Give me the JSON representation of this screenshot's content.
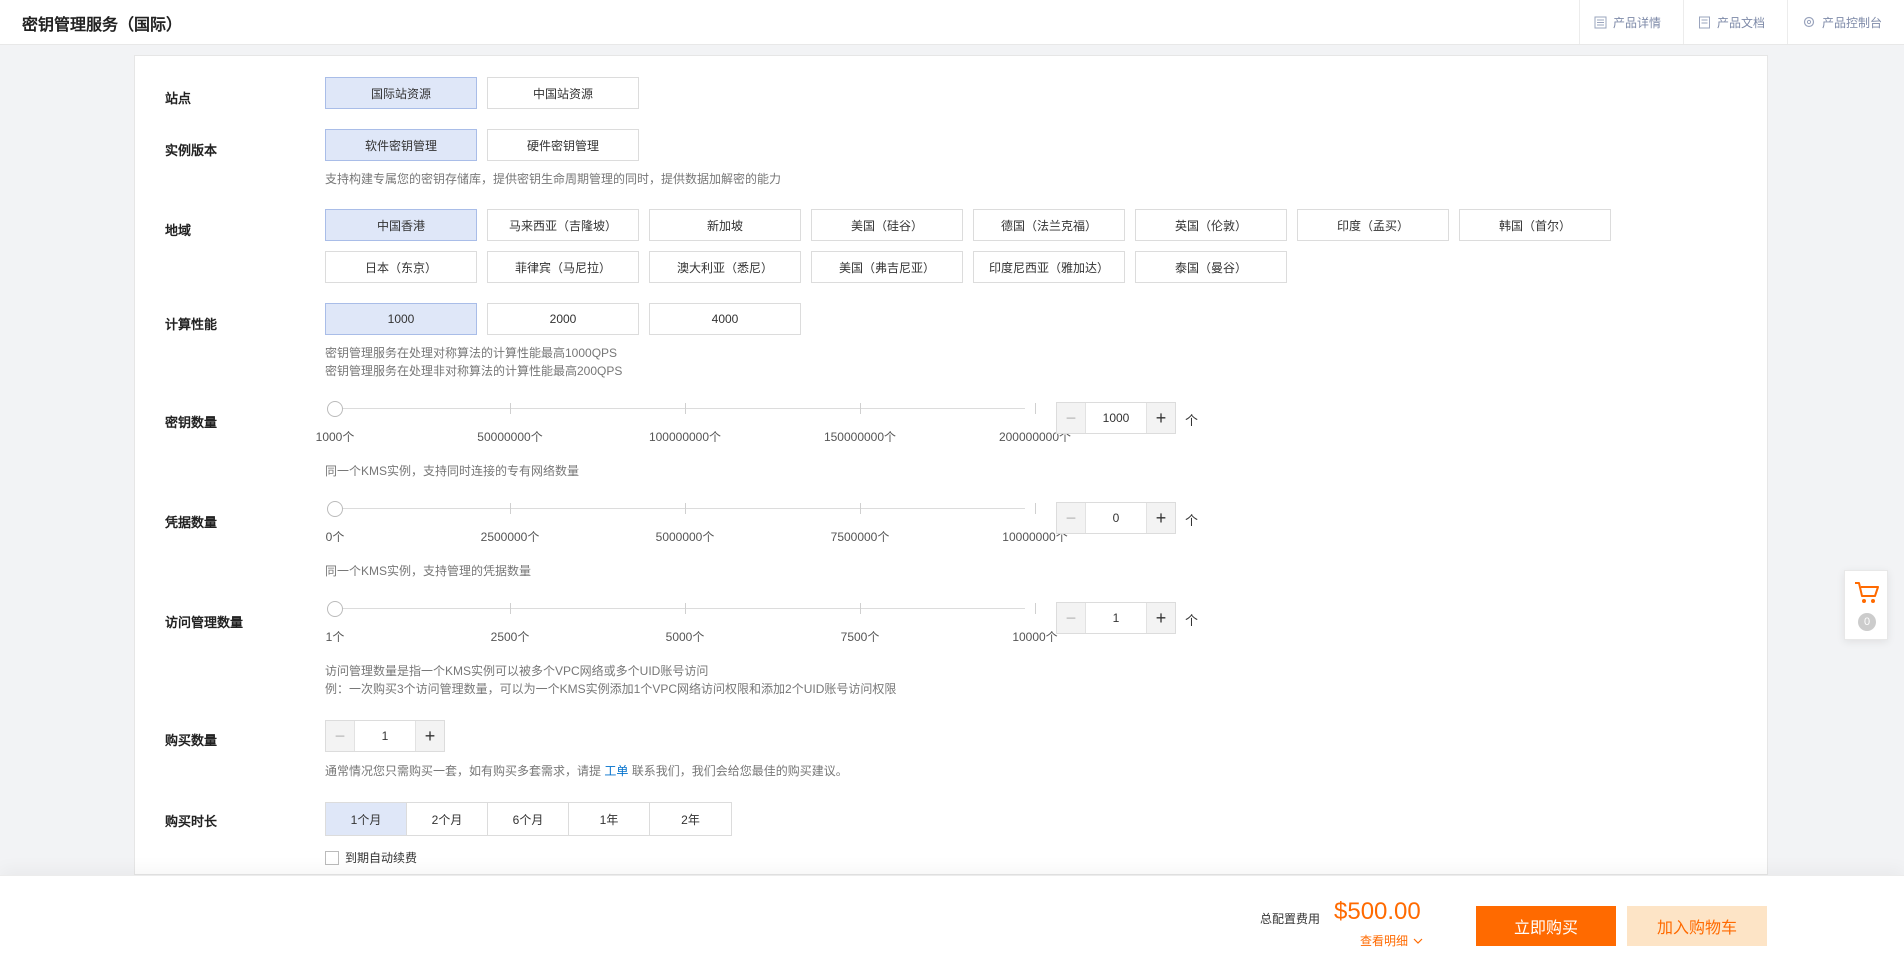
{
  "header": {
    "title": "密钥管理服务（国际）",
    "links": [
      "产品详情",
      "产品文档",
      "产品控制台"
    ]
  },
  "site": {
    "label": "站点",
    "options": [
      "国际站资源",
      "中国站资源"
    ],
    "selected": "国际站资源"
  },
  "edition": {
    "label": "实例版本",
    "options": [
      "软件密钥管理",
      "硬件密钥管理"
    ],
    "selected": "软件密钥管理",
    "hint": "支持构建专属您的密钥存储库，提供密钥生命周期管理的同时，提供数据加解密的能力"
  },
  "region": {
    "label": "地域",
    "options": [
      "中国香港",
      "马来西亚（吉隆坡）",
      "新加坡",
      "美国（硅谷）",
      "德国（法兰克福）",
      "英国（伦敦）",
      "印度（孟买）",
      "韩国（首尔）",
      "日本（东京）",
      "菲律宾（马尼拉）",
      "澳大利亚（悉尼）",
      "美国（弗吉尼亚）",
      "印度尼西亚（雅加达）",
      "泰国（曼谷）"
    ],
    "selected": "中国香港"
  },
  "performance": {
    "label": "计算性能",
    "options": [
      "1000",
      "2000",
      "4000"
    ],
    "selected": "1000",
    "hint1": "密钥管理服务在处理对称算法的计算性能最高1000QPS",
    "hint2": "密钥管理服务在处理非对称算法的计算性能最高200QPS"
  },
  "keys": {
    "label": "密钥数量",
    "ticks": [
      "1000个",
      "50000000个",
      "100000000个",
      "150000000个",
      "200000000个"
    ],
    "value": "1000",
    "unit": "个",
    "hint": "同一个KMS实例，支持同时连接的专有网络数量"
  },
  "secrets": {
    "label": "凭据数量",
    "ticks": [
      "0个",
      "2500000个",
      "5000000个",
      "7500000个",
      "10000000个"
    ],
    "value": "0",
    "unit": "个",
    "hint": "同一个KMS实例，支持管理的凭据数量"
  },
  "access": {
    "label": "访问管理数量",
    "ticks": [
      "1个",
      "2500个",
      "5000个",
      "7500个",
      "10000个"
    ],
    "value": "1",
    "unit": "个",
    "hint1": "访问管理数量是指一个KMS实例可以被多个VPC网络或多个UID账号访问",
    "hint2": "例：一次购买3个访问管理数量，可以为一个KMS实例添加1个VPC网络访问权限和添加2个UID账号访问权限"
  },
  "quantity": {
    "label": "购买数量",
    "value": "1",
    "hint_before": "通常情况您只需购买一套，如有购买多套需求，请提 ",
    "hint_link": "工单",
    "hint_after": " 联系我们，我们会给您最佳的购买建议。"
  },
  "duration": {
    "label": "购买时长",
    "options": [
      "1个月",
      "2个月",
      "6个月",
      "1年",
      "2年"
    ],
    "selected": "1个月",
    "auto_renew": "到期自动续费"
  },
  "footer": {
    "fee_label": "总配置费用",
    "price": "$500.00",
    "detail": "查看明细",
    "buy": "立即购买",
    "add_cart": "加入购物车"
  },
  "cart": {
    "count": "0"
  },
  "colors": {
    "accent": "#ff6a00",
    "selected_bg": "#dfe7f8",
    "link": "#0070cc"
  }
}
